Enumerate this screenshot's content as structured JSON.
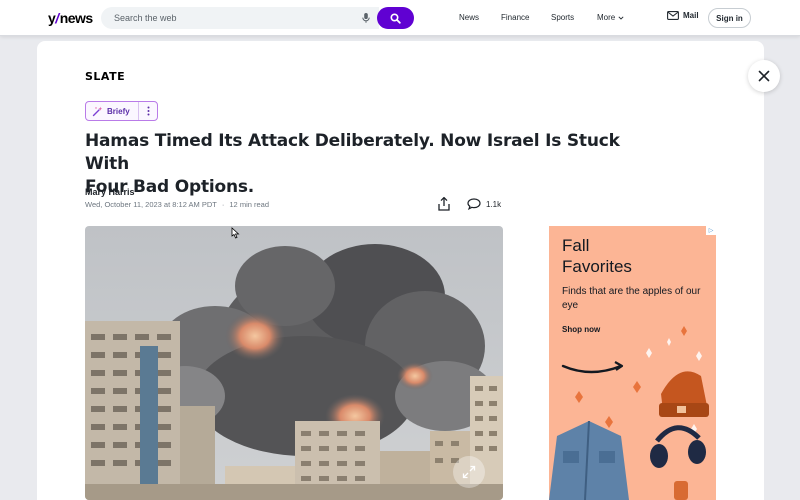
{
  "header": {
    "logo_main": "y",
    "logo_slash": "/",
    "logo_suffix": "news",
    "search_placeholder": "Search the web",
    "nav": [
      "News",
      "Finance",
      "Sports",
      "More"
    ],
    "mail_label": "Mail",
    "signin_label": "Sign in",
    "accent_color": "#6001d2"
  },
  "article": {
    "publisher": "SLATE",
    "briefly_label": "Briefy",
    "headline_line1": "Hamas Timed Its Attack Deliberately. Now Israel Is Stuck With",
    "headline_line2": "Four Bad Options.",
    "author": "Mary Harris",
    "date": "Wed, October 11, 2023 at 8:12 AM PDT",
    "separator": "·",
    "read_time": "12 min read",
    "comment_count": "1.1k"
  },
  "ad": {
    "title_line1": "Fall",
    "title_line2": "Favorites",
    "subtitle": "Finds that are the apples of our eye",
    "cta": "Shop now",
    "background_color": "#fcb595"
  },
  "icons": {
    "mic": "mic-icon",
    "search": "search-icon",
    "mail": "mail-icon",
    "share": "share-icon",
    "comment": "comment-icon",
    "expand": "expand-icon",
    "close": "close-icon",
    "sparkle": "sparkle-icon",
    "kebab": "kebab-icon",
    "ad_choices": "ad-choices-icon"
  }
}
